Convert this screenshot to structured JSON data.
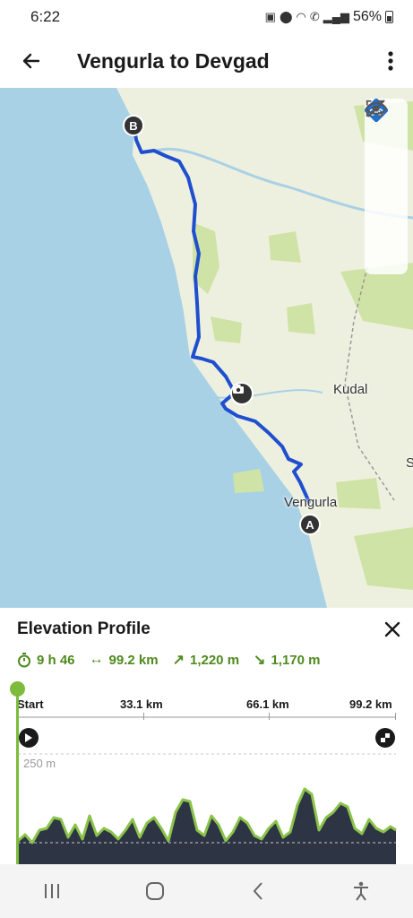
{
  "status_bar": {
    "time": "6:22",
    "battery_text": "56%",
    "icons": [
      "sim-icon",
      "location-icon",
      "wifi-icon",
      "wifi-calling-icon",
      "signal-icon",
      "battery-icon"
    ]
  },
  "app_bar": {
    "back_icon": "arrow-left-icon",
    "title": "Vengurla to Devgad",
    "menu_icon": "more-vertical-icon"
  },
  "map": {
    "labels": {
      "kudal": "Kudal",
      "vengurla": "Vengurla",
      "edge_letter": "S"
    },
    "markers": {
      "start": "A",
      "end": "B"
    },
    "controls": [
      "navigation-arrow-icon",
      "cycling-mode-icon",
      "recenter-icon",
      "hide-icon"
    ],
    "colors": {
      "sea": "#a9d1e6",
      "land": "#eef0df",
      "forest": "#cfe3a6",
      "route": "#1f4fcf"
    }
  },
  "elevation": {
    "title": "Elevation Profile",
    "stats": {
      "duration": "9 h 46",
      "distance": "99.2 km",
      "ascent": "1,220 m",
      "descent": "1,170 m"
    },
    "axis_labels": [
      "Start",
      "33.1 km",
      "66.1 km",
      "99.2 km"
    ],
    "elevation_label": "250 m",
    "colors": {
      "accent": "#4f8a1e",
      "fill": "#2d3544",
      "outline": "#8bc34a"
    }
  },
  "nav_bar": {
    "buttons": [
      "recent-apps-icon",
      "home-icon",
      "back-icon",
      "accessibility-icon"
    ]
  }
}
